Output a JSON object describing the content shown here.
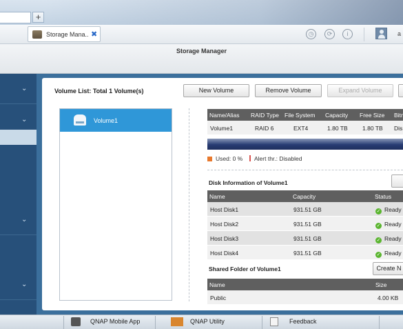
{
  "browser": {
    "new_tab_label": "+"
  },
  "app_tab": {
    "label": "Storage Mana..",
    "close_label": "✖"
  },
  "header_icons": [
    "clock-icon",
    "sync-icon",
    "info-icon"
  ],
  "user": {
    "name": "a"
  },
  "window_title": "Storage Manager",
  "sidebar": {
    "items": [
      "item-1",
      "item-2",
      "item-3",
      "item-4"
    ]
  },
  "volume_list": {
    "heading": "Volume List: Total 1 Volume(s)",
    "buttons": {
      "new": "New Volume",
      "remove": "Remove Volume",
      "expand": "Expand Volume"
    },
    "items": [
      {
        "label": "Volume1"
      }
    ]
  },
  "volume_table": {
    "columns": [
      "Name/Alias",
      "RAID Type",
      "File System",
      "Capacity",
      "Free Size",
      "Bitm"
    ],
    "row": [
      "Volume1",
      "RAID 6",
      "EXT4",
      "1.80 TB",
      "1.80 TB",
      "Dis"
    ]
  },
  "usage": {
    "used_label": "Used: 0 %",
    "used_percent": 0,
    "alert_label": "Alert thr.: Disabled",
    "used_color": "#e8792d",
    "alert_color": "#d9534f"
  },
  "disk_info": {
    "title": "Disk Information of Volume1",
    "columns": [
      "Name",
      "Capacity",
      "Status"
    ],
    "rows": [
      {
        "name": "Host Disk1",
        "capacity": "931.51 GB",
        "status": "Ready"
      },
      {
        "name": "Host Disk2",
        "capacity": "931.51 GB",
        "status": "Ready"
      },
      {
        "name": "Host Disk3",
        "capacity": "931.51 GB",
        "status": "Ready"
      },
      {
        "name": "Host Disk4",
        "capacity": "931.51 GB",
        "status": "Ready"
      }
    ]
  },
  "shared_folder": {
    "title": "Shared Folder of Volume1",
    "button": "Create N",
    "columns": [
      "Name",
      "Size"
    ],
    "rows": [
      {
        "name": "Public",
        "size": "4.00 KB"
      }
    ]
  },
  "taskbar": {
    "items": [
      "QNAP Mobile App",
      "QNAP Utility",
      "Feedback"
    ]
  }
}
